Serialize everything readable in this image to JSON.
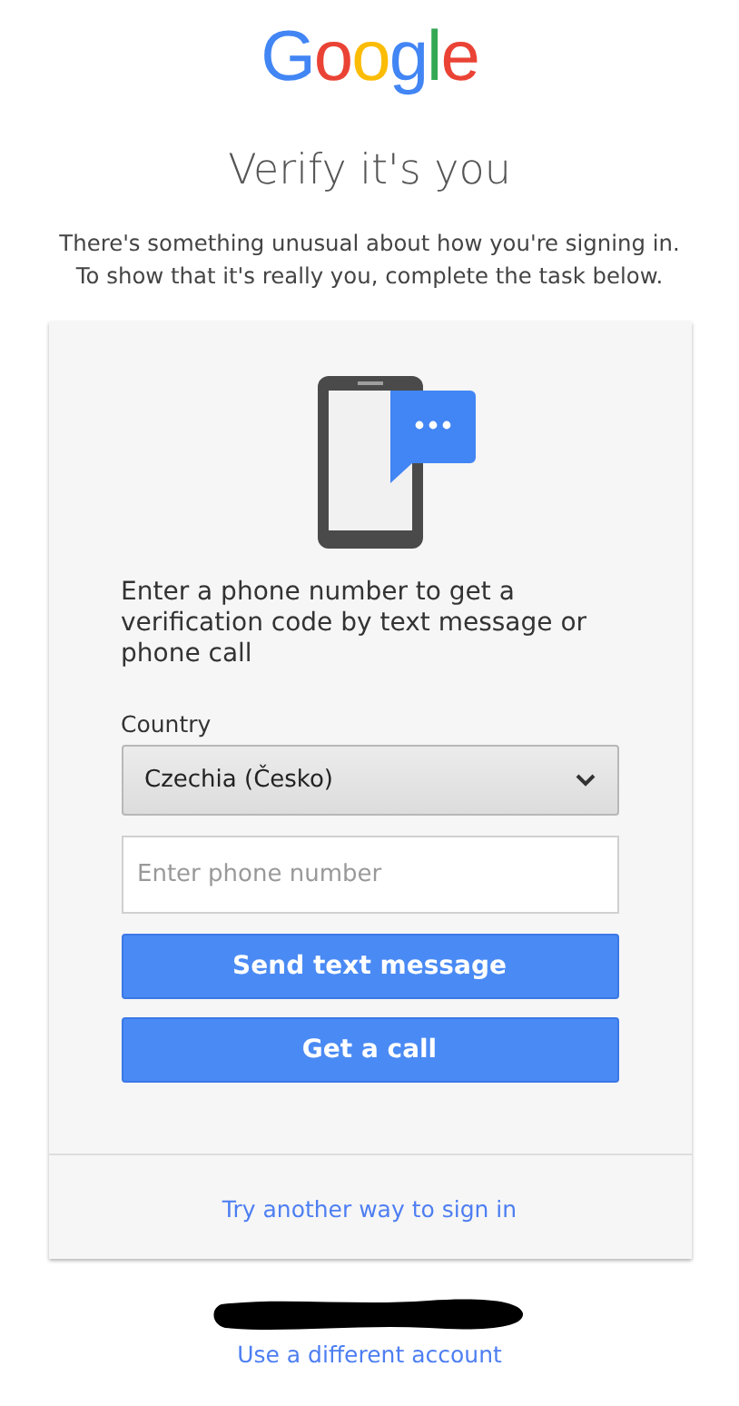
{
  "logo": "Google",
  "title": "Verify it's you",
  "subtitle": "There's something unusual about how you're signing in. To show that it's really you, complete the task below.",
  "card": {
    "instruction": "Enter a phone number to get a verification code by text message or phone call",
    "country": {
      "label": "Country",
      "value": "Czechia (Česko)"
    },
    "phone": {
      "placeholder": "Enter phone number"
    },
    "buttons": [
      "Send text message",
      "Get a call"
    ],
    "alternate_link": "Try another way to sign in"
  },
  "switch_account_link": "Use a different account"
}
